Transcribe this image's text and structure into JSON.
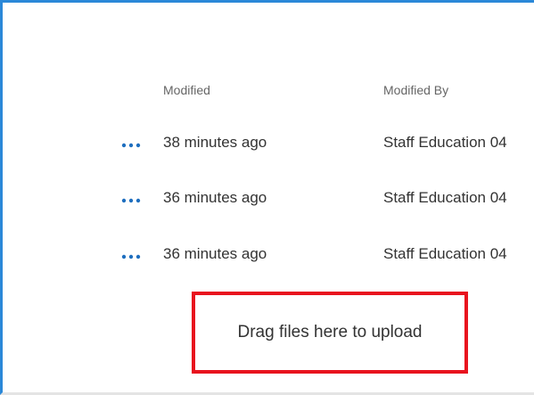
{
  "columns": {
    "modified": "Modified",
    "modified_by": "Modified By"
  },
  "rows": [
    {
      "more_icon": "more-dots-icon",
      "modified": "38 minutes ago",
      "modified_by": "Staff Education 04"
    },
    {
      "more_icon": "more-dots-icon",
      "modified": "36 minutes ago",
      "modified_by": "Staff Education 04"
    },
    {
      "more_icon": "more-dots-icon",
      "modified": "36 minutes ago",
      "modified_by": "Staff Education 04"
    }
  ],
  "upload": {
    "label": "Drag files here to upload"
  },
  "colors": {
    "accent": "#2b88d8",
    "more_icon": "#1f6fbf",
    "highlight_border": "#e8131e",
    "text": "#333333",
    "header_text": "#666666"
  }
}
